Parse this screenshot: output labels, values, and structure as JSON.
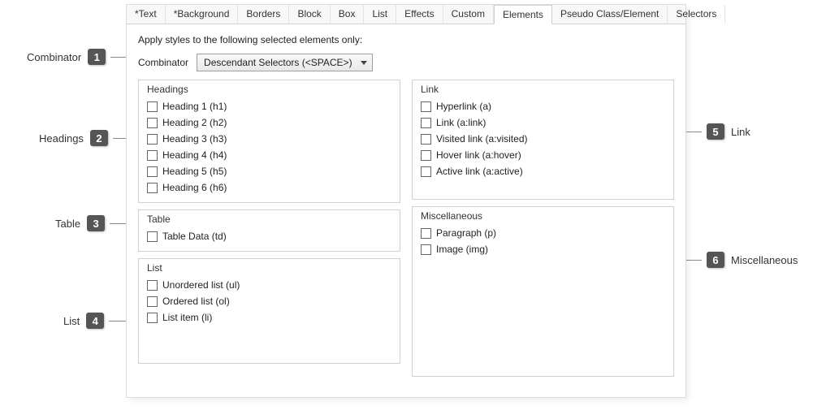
{
  "tabs": {
    "t0": "*Text",
    "t1": "*Background",
    "t2": "Borders",
    "t3": "Block",
    "t4": "Box",
    "t5": "List",
    "t6": "Effects",
    "t7": "Custom",
    "t8": "Elements",
    "t9": "Pseudo Class/Element",
    "t10": "Selectors"
  },
  "intro": "Apply styles to the following selected elements only:",
  "combinator": {
    "label": "Combinator",
    "value": "Descendant Selectors (<SPACE>)"
  },
  "groups": {
    "headings": {
      "legend": "Headings",
      "items": [
        "Heading 1 (h1)",
        "Heading 2 (h2)",
        "Heading 3 (h3)",
        "Heading 4 (h4)",
        "Heading 5 (h5)",
        "Heading 6 (h6)"
      ]
    },
    "table": {
      "legend": "Table",
      "items": [
        "Table Data (td)"
      ]
    },
    "list": {
      "legend": "List",
      "items": [
        "Unordered list (ul)",
        "Ordered list (ol)",
        "List item (li)"
      ]
    },
    "link": {
      "legend": "Link",
      "items": [
        "Hyperlink (a)",
        "Link (a:link)",
        "Visited link (a:visited)",
        "Hover link (a:hover)",
        "Active link (a:active)"
      ]
    },
    "misc": {
      "legend": "Miscellaneous",
      "items": [
        "Paragraph (p)",
        "Image (img)"
      ]
    }
  },
  "callouts": {
    "c1": {
      "num": "1",
      "label": "Combinator"
    },
    "c2": {
      "num": "2",
      "label": "Headings"
    },
    "c3": {
      "num": "3",
      "label": "Table"
    },
    "c4": {
      "num": "4",
      "label": "List"
    },
    "c5": {
      "num": "5",
      "label": "Link"
    },
    "c6": {
      "num": "6",
      "label": "Miscellaneous"
    }
  }
}
